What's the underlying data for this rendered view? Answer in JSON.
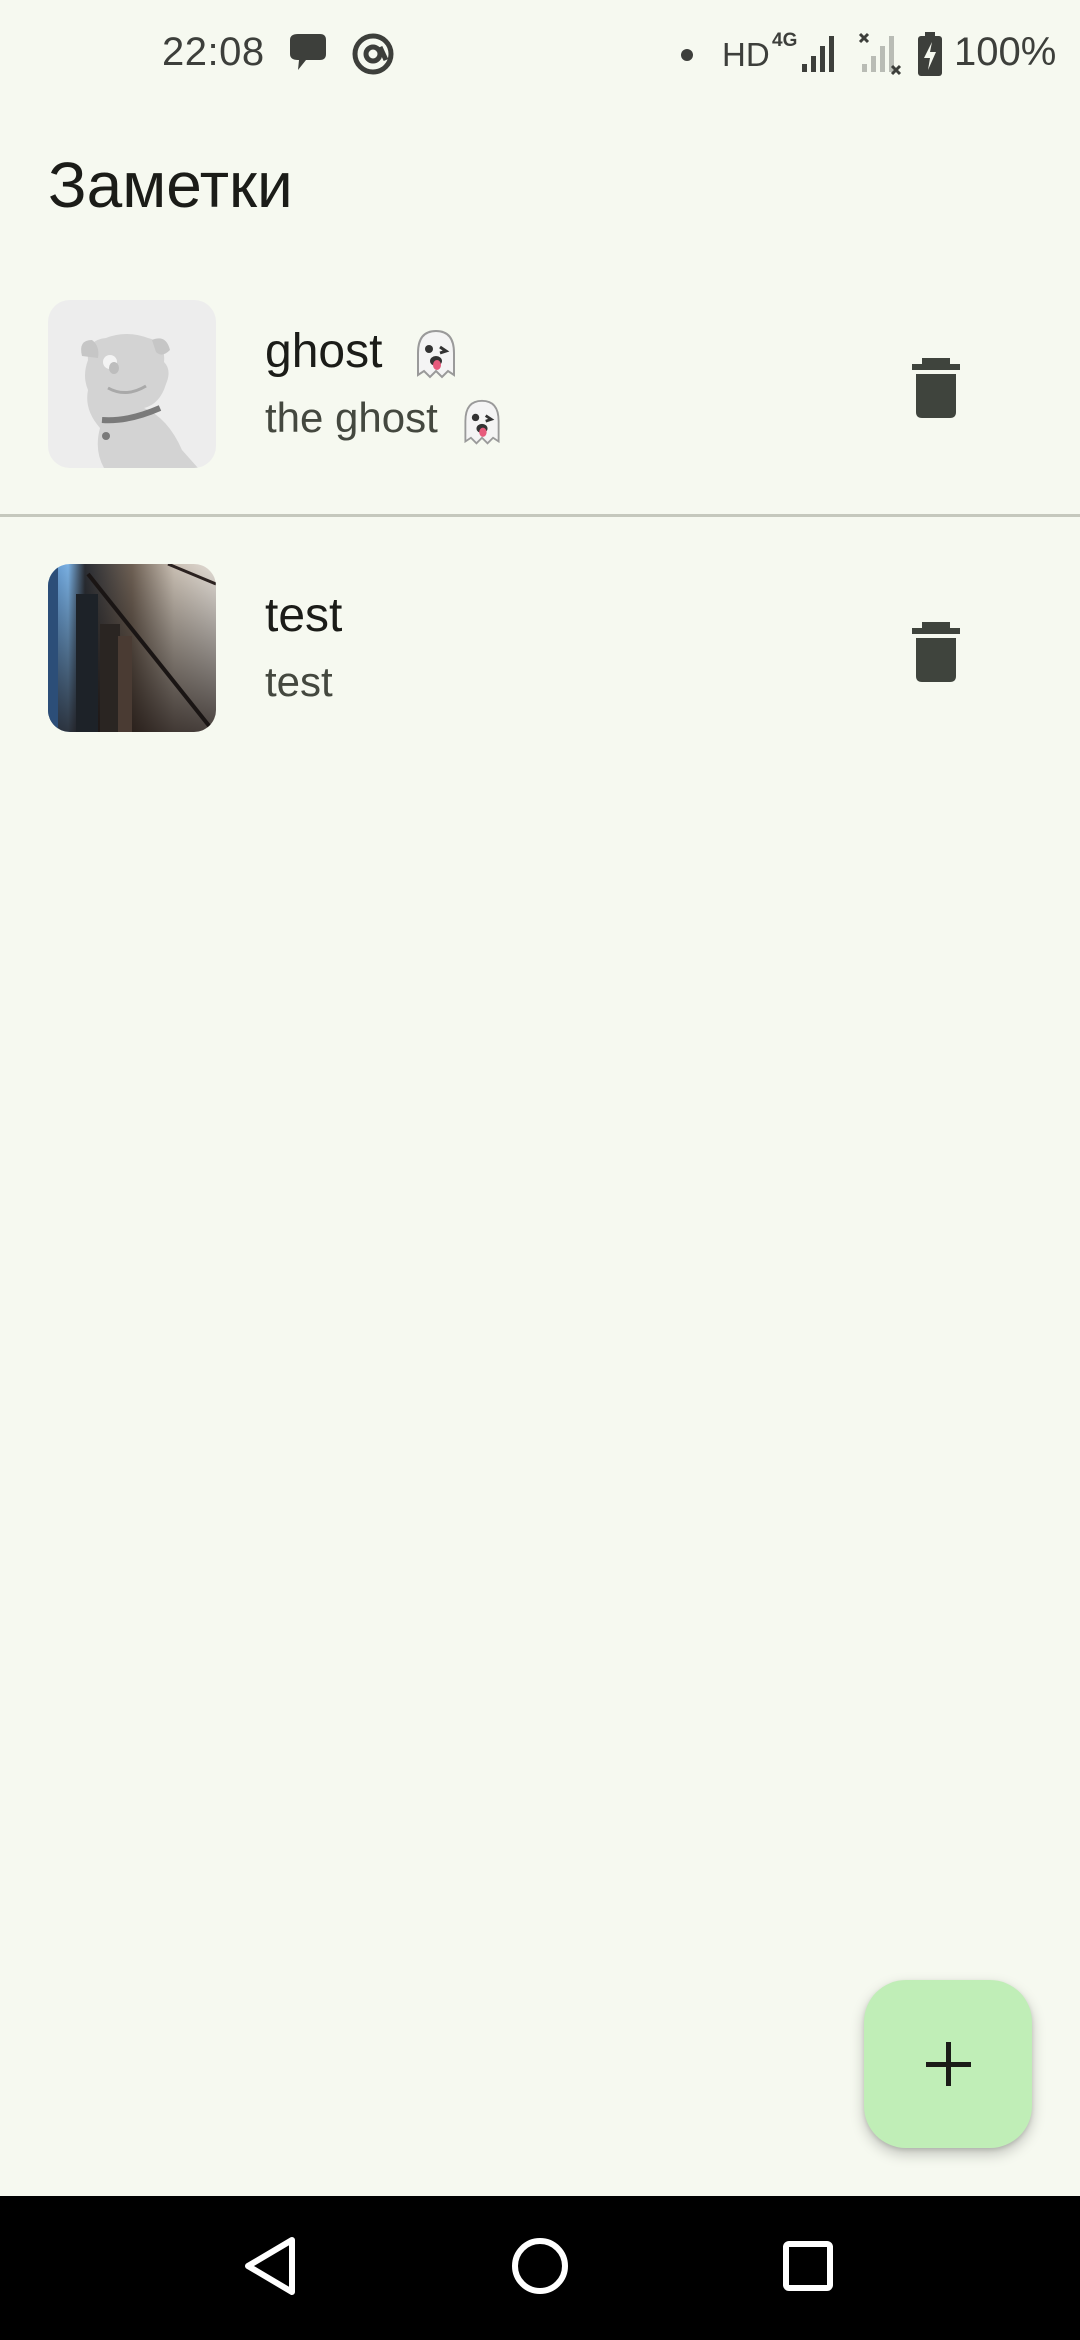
{
  "status_bar": {
    "time": "22:08",
    "network_hd": "HD",
    "network_gen": "4G",
    "battery_percent": "100%",
    "icons": [
      "chat-bubble-icon",
      "at-sign-icon",
      "notification-dot-icon",
      "signal-sim1-icon",
      "signal-sim2-no-service-icon",
      "battery-charging-icon"
    ]
  },
  "header": {
    "title": "Заметки"
  },
  "notes": [
    {
      "title": "ghost",
      "title_emoji": "ghost-emoji-icon",
      "text": "the ghost",
      "text_emoji": "ghost-emoji-icon",
      "thumbnail": "dog-placeholder-icon",
      "delete_icon": "trash-icon"
    },
    {
      "title": "test",
      "text": "test",
      "thumbnail": "photo-thumbnail",
      "delete_icon": "trash-icon"
    }
  ],
  "fab": {
    "icon": "plus-icon"
  },
  "nav_bar": {
    "icons": [
      "back-triangle-icon",
      "home-circle-icon",
      "recents-square-icon"
    ]
  },
  "colors": {
    "background": "#f6f9f0",
    "fab_background": "#c0eeb7",
    "icon_dark": "#3f443d",
    "divider": "#c5c8bd",
    "nav_bar": "#000000"
  }
}
